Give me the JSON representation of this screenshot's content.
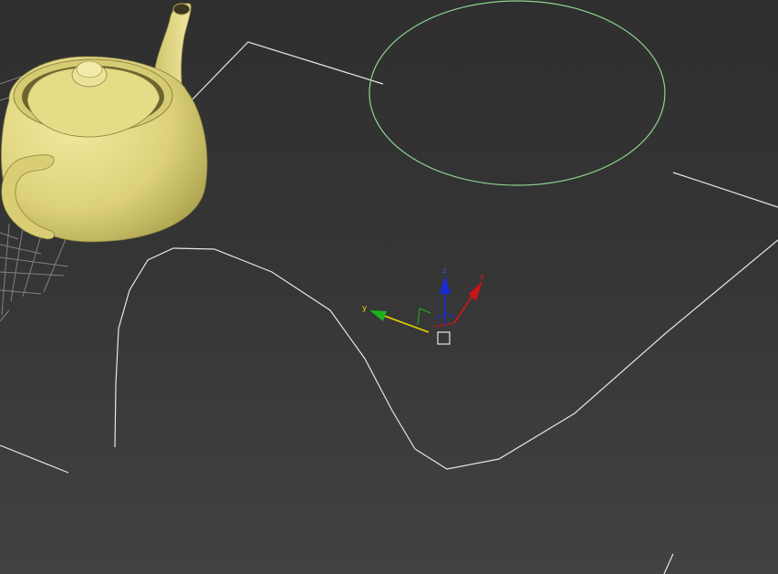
{
  "viewport": {
    "gizmo": {
      "x_label": "x",
      "y_label": "y",
      "z_label": "z"
    },
    "colors": {
      "background_top": "#2f2f2f",
      "background_bottom": "#424242",
      "spline": "#e6e6e6",
      "circle": "#8fd48f",
      "teapot": "#e0d67c",
      "grid": "#9a9a9a",
      "axis_x": "#cc1a1a",
      "axis_y": "#e6d500",
      "axis_z": "#1a2bd6",
      "axis_x_head": "#c81414",
      "axis_y_head": "#1fb01f",
      "axis_z_head": "#1a2bd6"
    },
    "objects": {
      "teapot": "teapot",
      "circle": "circle-shape",
      "spline": "line-shape",
      "pivot": "pivot-square-icon"
    }
  }
}
